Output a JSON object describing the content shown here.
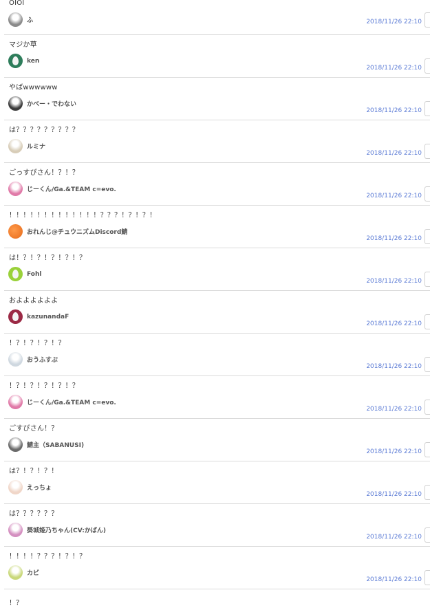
{
  "comments": [
    {
      "text": "OIOI",
      "user": "ふ",
      "time": "2018/11/26 22:10",
      "avatar": {
        "icon": "photo-avatar",
        "color": "#8a8a8a"
      }
    },
    {
      "text": "マジか草",
      "user": "ken",
      "time": "2018/11/26 22:10",
      "avatar": {
        "icon": "egg-avatar",
        "color": "#2e7d5b"
      }
    },
    {
      "text": "やばwwwwww",
      "user": "かべー・でわない",
      "time": "2018/11/26 22:10",
      "avatar": {
        "icon": "character-avatar",
        "color": "#3b3b3b"
      }
    },
    {
      "text": "は？？？？？？？？？",
      "user": "ルミナ",
      "time": "2018/11/26 22:10",
      "avatar": {
        "icon": "character-avatar",
        "color": "#d8cdb8"
      }
    },
    {
      "text": "ごっすぴさん！？！？",
      "user": "じーくん/Ga.&TEAM c=evo.",
      "time": "2018/11/26 22:10",
      "avatar": {
        "icon": "character-avatar",
        "color": "#e07aa8"
      }
    },
    {
      "text": "！！！！！！！！！！！！！？？？！？！？！",
      "user": "おれんじ@チュウニズムDiscord鯖",
      "time": "2018/11/26 22:10",
      "avatar": {
        "icon": "orange-avatar",
        "color": "#e66a1a"
      }
    },
    {
      "text": "は！？！？！？！？！？",
      "user": "Fohl",
      "time": "2018/11/26 22:10",
      "avatar": {
        "icon": "egg-avatar",
        "color": "#9ad13a"
      }
    },
    {
      "text": "およよよよよよ",
      "user": "kazunandaF",
      "time": "2018/11/26 22:10",
      "avatar": {
        "icon": "egg-avatar",
        "color": "#9b2a45"
      }
    },
    {
      "text": "！？！？！？！？",
      "user": "おうふすぷ",
      "time": "2018/11/26 22:10",
      "avatar": {
        "icon": "character-avatar",
        "color": "#cfd8e0"
      }
    },
    {
      "text": "！？！？！？！？！？",
      "user": "じーくん/Ga.&TEAM c=evo.",
      "time": "2018/11/26 22:10",
      "avatar": {
        "icon": "character-avatar",
        "color": "#e07aa8"
      }
    },
    {
      "text": "ごすぴさん！？",
      "user": "鯖主（SABANUSI)",
      "time": "2018/11/26 22:10",
      "avatar": {
        "icon": "character-avatar",
        "color": "#6a6a6a"
      }
    },
    {
      "text": "は？！？！？！",
      "user": "えっちょ",
      "time": "2018/11/26 22:10",
      "avatar": {
        "icon": "character-avatar",
        "color": "#f0d6c8"
      }
    },
    {
      "text": "は？？？？？？",
      "user": "葵城姫乃ちゃん(CV:かばん)",
      "time": "2018/11/26 22:10",
      "avatar": {
        "icon": "character-avatar",
        "color": "#d48fc0"
      }
    },
    {
      "text": "！！！！？？？！？！？",
      "user": "カビ",
      "time": "2018/11/26 22:10",
      "avatar": {
        "icon": "character-avatar",
        "color": "#c9d87a"
      }
    }
  ],
  "last_comment": {
    "text": "！？"
  }
}
